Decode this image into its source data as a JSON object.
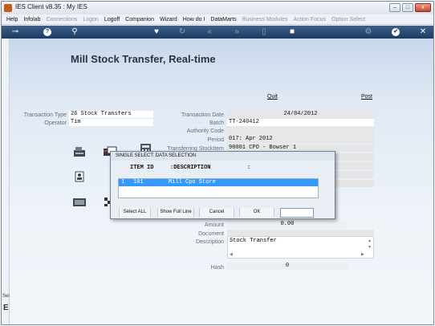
{
  "window": {
    "title": "IES Client v8.35 : My IES",
    "minimize": "–",
    "maximize": "□",
    "close": "x"
  },
  "menu": [
    {
      "label": "Help",
      "enabled": true
    },
    {
      "label": "Infolab",
      "enabled": true
    },
    {
      "label": "Connections",
      "enabled": false
    },
    {
      "label": "Logon",
      "enabled": false
    },
    {
      "label": "Logoff",
      "enabled": true
    },
    {
      "label": "Companion",
      "enabled": true
    },
    {
      "label": "Wizard",
      "enabled": true
    },
    {
      "label": "How do I",
      "enabled": true
    },
    {
      "label": "DataMarts",
      "enabled": true
    },
    {
      "label": "Business Modules",
      "enabled": false
    },
    {
      "label": "Action Focus",
      "enabled": false
    },
    {
      "label": "Option Select",
      "enabled": false
    }
  ],
  "toolbar": {
    "key": "⊸",
    "help": "?",
    "search": "⚲",
    "heart": "♥",
    "refresh": "↻",
    "back": "«",
    "forward": "»",
    "page": "▯",
    "stop": "■",
    "settings": "⚙",
    "ok": "✔",
    "close": "✕"
  },
  "page": {
    "title": "Mill Stock Transfer, Real-time",
    "quit": "Quit",
    "post": "Post"
  },
  "form": {
    "transaction_type_label": "Transaction Type",
    "transaction_type_value": "26 Stock Transfers",
    "operator_label": "Operator",
    "operator_value": "Tim",
    "transaction_date_label": "Transaction Date",
    "transaction_date_value": "24/04/2012",
    "batch_label": "Batch",
    "batch_value": "TT-240412",
    "authority_code_label": "Authority Code",
    "authority_code_value": "",
    "period_label": "Period",
    "period_value": "017: Apr 2012",
    "transferring_stockitem_label": "Transferring StockItem",
    "transferring_stockitem_value": "90001 CPO - Bowser 1",
    "amount_label": "Amount",
    "amount_value": "0.00",
    "document_label": "Document",
    "document_value": "",
    "description_label": "Description",
    "description_value": "Stock Transfer",
    "hash_label": "Hash",
    "hash_value": "0"
  },
  "left_strip": {
    "text": "Sei",
    "letter": "E"
  },
  "dialog": {
    "title": "SINGLE SELECT: DATA SELECTION",
    "headers": [
      "ITEM ID",
      ":DESCRIPTION",
      ":"
    ],
    "rows": [
      {
        "num": "1",
        "item_id": "101",
        "description": "Mill Cpo Store"
      }
    ],
    "buttons": {
      "select_all": "Select ALL",
      "show_full_line": "Show Full Line",
      "cancel": "Cancel",
      "ok": "OK"
    },
    "input_value": ""
  },
  "colors": {
    "toolbar": "#1d3b62",
    "selection": "#3399ff",
    "title_text": "#2c3440"
  }
}
